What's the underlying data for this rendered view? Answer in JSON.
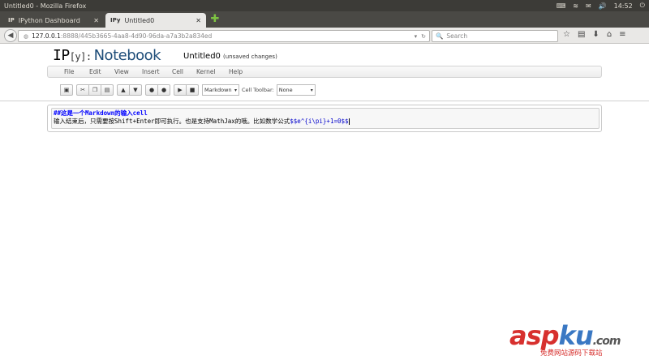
{
  "os": {
    "window_title": "Untitled0 - Mozilla Firefox",
    "time": "14:52"
  },
  "browser": {
    "tabs": [
      {
        "favicon": "IP",
        "label": "IPython Dashboard",
        "active": false
      },
      {
        "favicon": "IPy",
        "label": "Untitled0",
        "active": true
      }
    ],
    "url_host": "127.0.0.1",
    "url_rest": ":8888/445b3665-4aa8-4d90-96da-a7a3b2a834ed",
    "search_placeholder": "Search"
  },
  "notebook": {
    "logo_ip": "IP",
    "logo_y": "[y]:",
    "logo_word": "Notebook",
    "name": "Untitled0",
    "save_status": "(unsaved changes)",
    "menu": [
      "File",
      "Edit",
      "View",
      "Insert",
      "Cell",
      "Kernel",
      "Help"
    ],
    "toolbar": {
      "cell_type": "Markdown",
      "cell_toolbar_label": "Cell Toolbar:",
      "cell_toolbar_value": "None"
    },
    "cell": {
      "line1": "##这是一个Markdown的输入cell",
      "line2_text": "输入结束后，只需要按Shift+Enter即可执行。也是支持MathJax的哦。比如数学公式",
      "line2_math": "$$e^{i\\pi}+1=0$$"
    }
  },
  "watermark": {
    "main_a": "asp",
    "main_b": "ku",
    "dot": ".com",
    "sub": "免费网站源码下载站"
  },
  "colors": {
    "os_bar": "#3c3b37",
    "logo_blue": "#1e4d79",
    "markdown_header": "#0000ff",
    "watermark_red": "#d7302e",
    "watermark_blue": "#3a78c3"
  }
}
